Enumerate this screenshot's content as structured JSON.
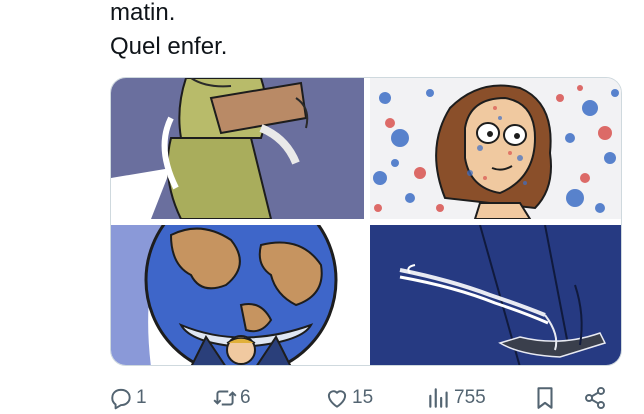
{
  "tweet": {
    "text_lines": [
      "matin.",
      "Quel enfer."
    ]
  },
  "media": {
    "images": [
      {
        "description_icon": "cartoon-figure-green-dress"
      },
      {
        "description_icon": "cartoon-woman-splattered"
      },
      {
        "description_icon": "cartoon-globe-atlas"
      },
      {
        "description_icon": "cartoon-swing-sketch"
      }
    ]
  },
  "actions": {
    "reply": {
      "icon": "reply-icon",
      "count": "1"
    },
    "retweet": {
      "icon": "retweet-icon",
      "count": "6"
    },
    "like": {
      "icon": "heart-icon",
      "count": "15"
    },
    "views": {
      "icon": "views-icon",
      "count": "755"
    },
    "bookmark": {
      "icon": "bookmark-icon"
    },
    "share": {
      "icon": "share-icon"
    }
  },
  "colors": {
    "text": "#0f1419",
    "secondary": "#536471",
    "border": "#cfd9de"
  }
}
